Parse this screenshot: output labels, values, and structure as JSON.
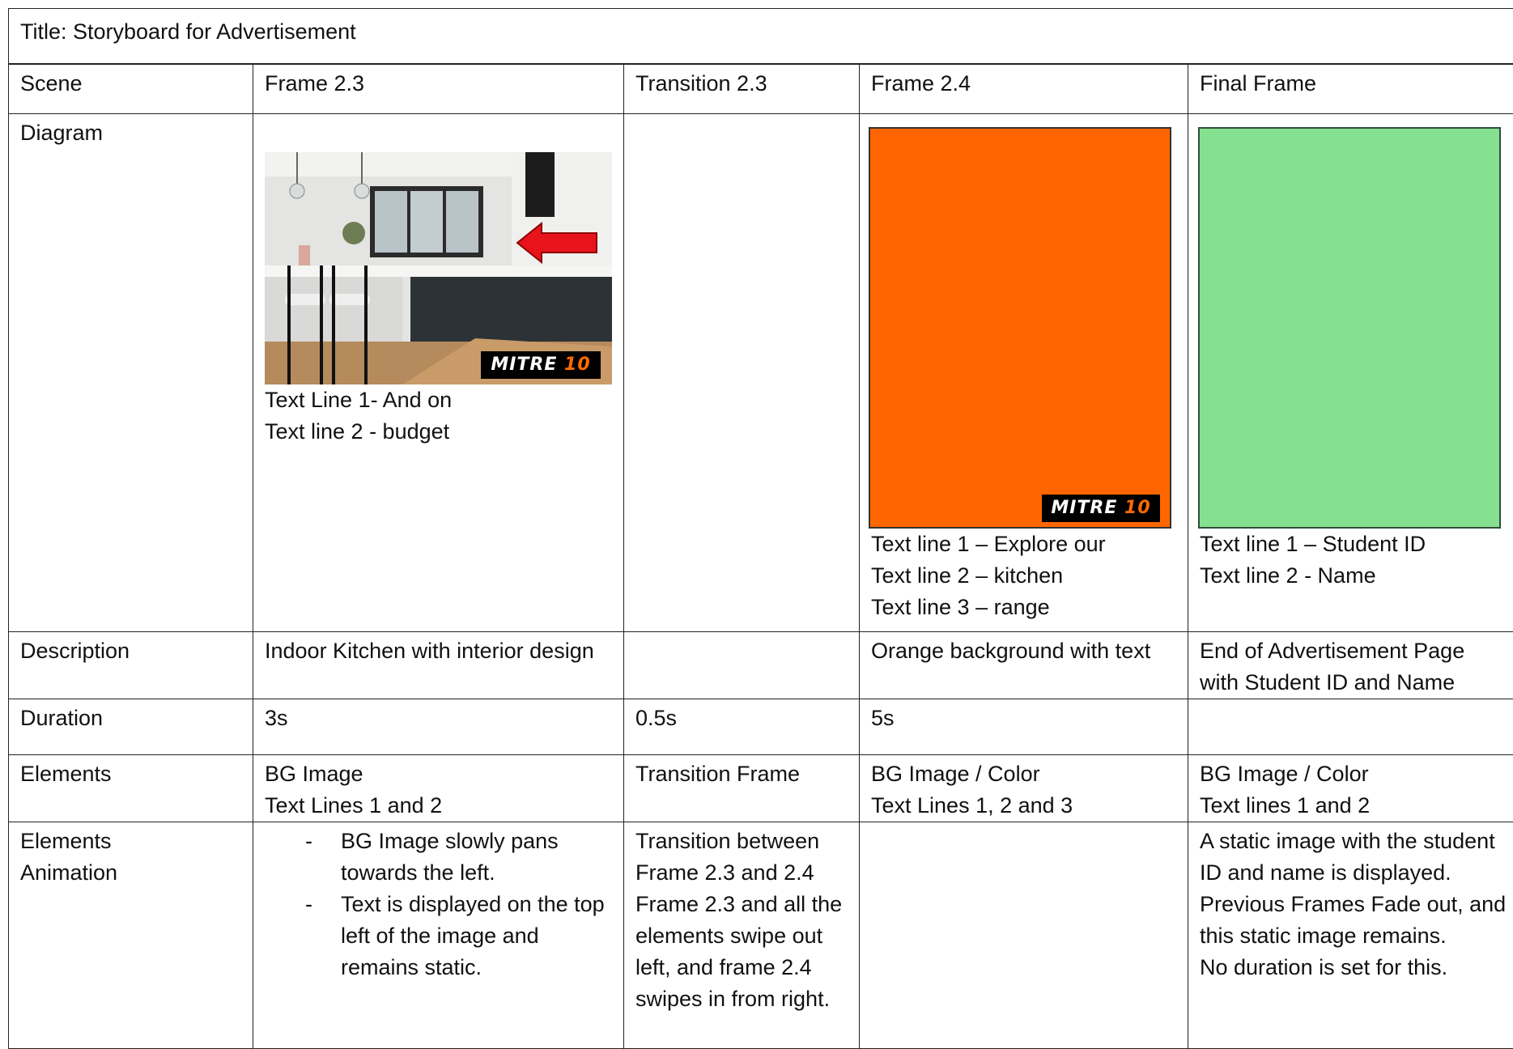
{
  "title": "Title: Storyboard for Advertisement",
  "colors": {
    "frame_2_4_background": "#ff6600",
    "final_frame_background": "#85e18f",
    "arrow": "#e8141b",
    "brand_accent": "#ff6a00"
  },
  "brand": {
    "name": "MITRE",
    "number": "10"
  },
  "rows": {
    "scene": {
      "label": "Scene",
      "cells": [
        "Frame 2.3",
        "Transition 2.3",
        "Frame 2.4",
        "Final Frame"
      ]
    },
    "diagram": {
      "label": "Diagram",
      "frame_2_3": {
        "image_icon": "kitchen-photo",
        "text_lines": [
          "Text Line 1- And on",
          "Text line 2 - budget"
        ]
      },
      "frame_2_4": {
        "text_lines": [
          "Text line 1 – Explore our",
          "Text line 2 – kitchen",
          "Text line 3 – range"
        ]
      },
      "final_frame": {
        "text_lines": [
          "Text line 1 – Student ID",
          "Text line 2 - Name"
        ]
      }
    },
    "description": {
      "label": "Description",
      "cells": [
        "Indoor Kitchen with interior design",
        "",
        "Orange background with text",
        "End of Advertisement Page with Student ID and Name"
      ]
    },
    "duration": {
      "label": "Duration",
      "cells": [
        "3s",
        "0.5s",
        "5s",
        ""
      ]
    },
    "elements": {
      "label": "Elements",
      "cells": [
        [
          "BG Image",
          "Text Lines 1 and 2"
        ],
        [
          "Transition Frame"
        ],
        [
          "BG Image / Color",
          "Text Lines 1, 2 and 3"
        ],
        [
          "BG Image / Color",
          "Text lines 1 and 2"
        ]
      ]
    },
    "animation": {
      "label_lines": [
        "Elements",
        "Animation"
      ],
      "frame_2_3": [
        "BG Image slowly pans towards the left.",
        "Text is displayed on the top left of the image and remains static."
      ],
      "transition_2_3": "Transition between Frame 2.3 and 2.4 Frame 2.3 and all the elements swipe out left, and frame 2.4 swipes in from right.",
      "frame_2_4": "",
      "final_frame": [
        "A static image with the student ID and name is displayed.",
        "Previous Frames Fade out, and this static image remains.",
        "No duration is set for this."
      ]
    }
  }
}
